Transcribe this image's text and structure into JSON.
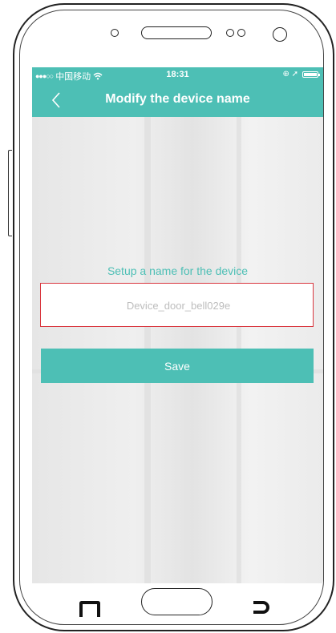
{
  "status_bar": {
    "carrier": "中国移动",
    "signal_dots": "●●●○○",
    "wifi_icon": "wifi-icon",
    "time": "18:31",
    "right_icons": "⊕ ➚"
  },
  "nav": {
    "title": "Modify the device name",
    "back_icon": "chevron-left-icon"
  },
  "form": {
    "label": "Setup a name for the device",
    "device_name_placeholder": "Device_door_bell029e",
    "device_name_value": ""
  },
  "actions": {
    "save_label": "Save"
  },
  "colors": {
    "accent": "#4dbfb5",
    "error_border": "#d9363e",
    "placeholder": "#bdbdbd"
  }
}
